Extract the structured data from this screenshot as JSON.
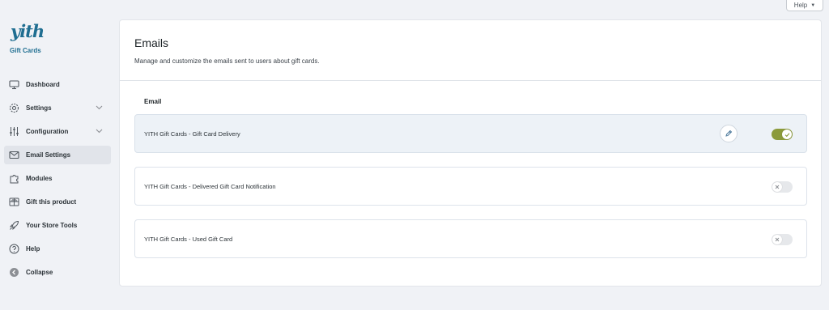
{
  "help_tab": {
    "label": "Help"
  },
  "brand": {
    "logo": "yith",
    "subtitle": "Gift Cards",
    "color": "#1f6e91"
  },
  "sidebar": {
    "items": [
      {
        "label": "Dashboard",
        "icon": "monitor-icon",
        "expandable": false,
        "active": false
      },
      {
        "label": "Settings",
        "icon": "gear-icon",
        "expandable": true,
        "active": false
      },
      {
        "label": "Configuration",
        "icon": "sliders-icon",
        "expandable": true,
        "active": false
      },
      {
        "label": "Email Settings",
        "icon": "envelope-icon",
        "expandable": false,
        "active": true
      },
      {
        "label": "Modules",
        "icon": "puzzle-icon",
        "expandable": false,
        "active": false
      },
      {
        "label": "Gift this product",
        "icon": "gift-icon",
        "expandable": false,
        "active": false
      },
      {
        "label": "Your Store Tools",
        "icon": "rocket-icon",
        "expandable": false,
        "active": false
      },
      {
        "label": "Help",
        "icon": "question-icon",
        "expandable": false,
        "active": false
      },
      {
        "label": "Collapse",
        "icon": "collapse-arrow-icon",
        "expandable": false,
        "active": false
      }
    ]
  },
  "main": {
    "title": "Emails",
    "description": "Manage and customize the emails sent to users about gift cards.",
    "column_header": "Email",
    "emails": [
      {
        "name": "YITH Gift Cards - Gift Card Delivery",
        "enabled": true,
        "highlighted": true
      },
      {
        "name": "YITH Gift Cards - Delivered Gift Card Notification",
        "enabled": false,
        "highlighted": false
      },
      {
        "name": "YITH Gift Cards - Used Gift Card",
        "enabled": false,
        "highlighted": false
      }
    ]
  },
  "colors": {
    "toggle_on": "#8b9a3a",
    "toggle_off": "#e6e8eb",
    "active_nav_bg": "#e1e4ea"
  }
}
